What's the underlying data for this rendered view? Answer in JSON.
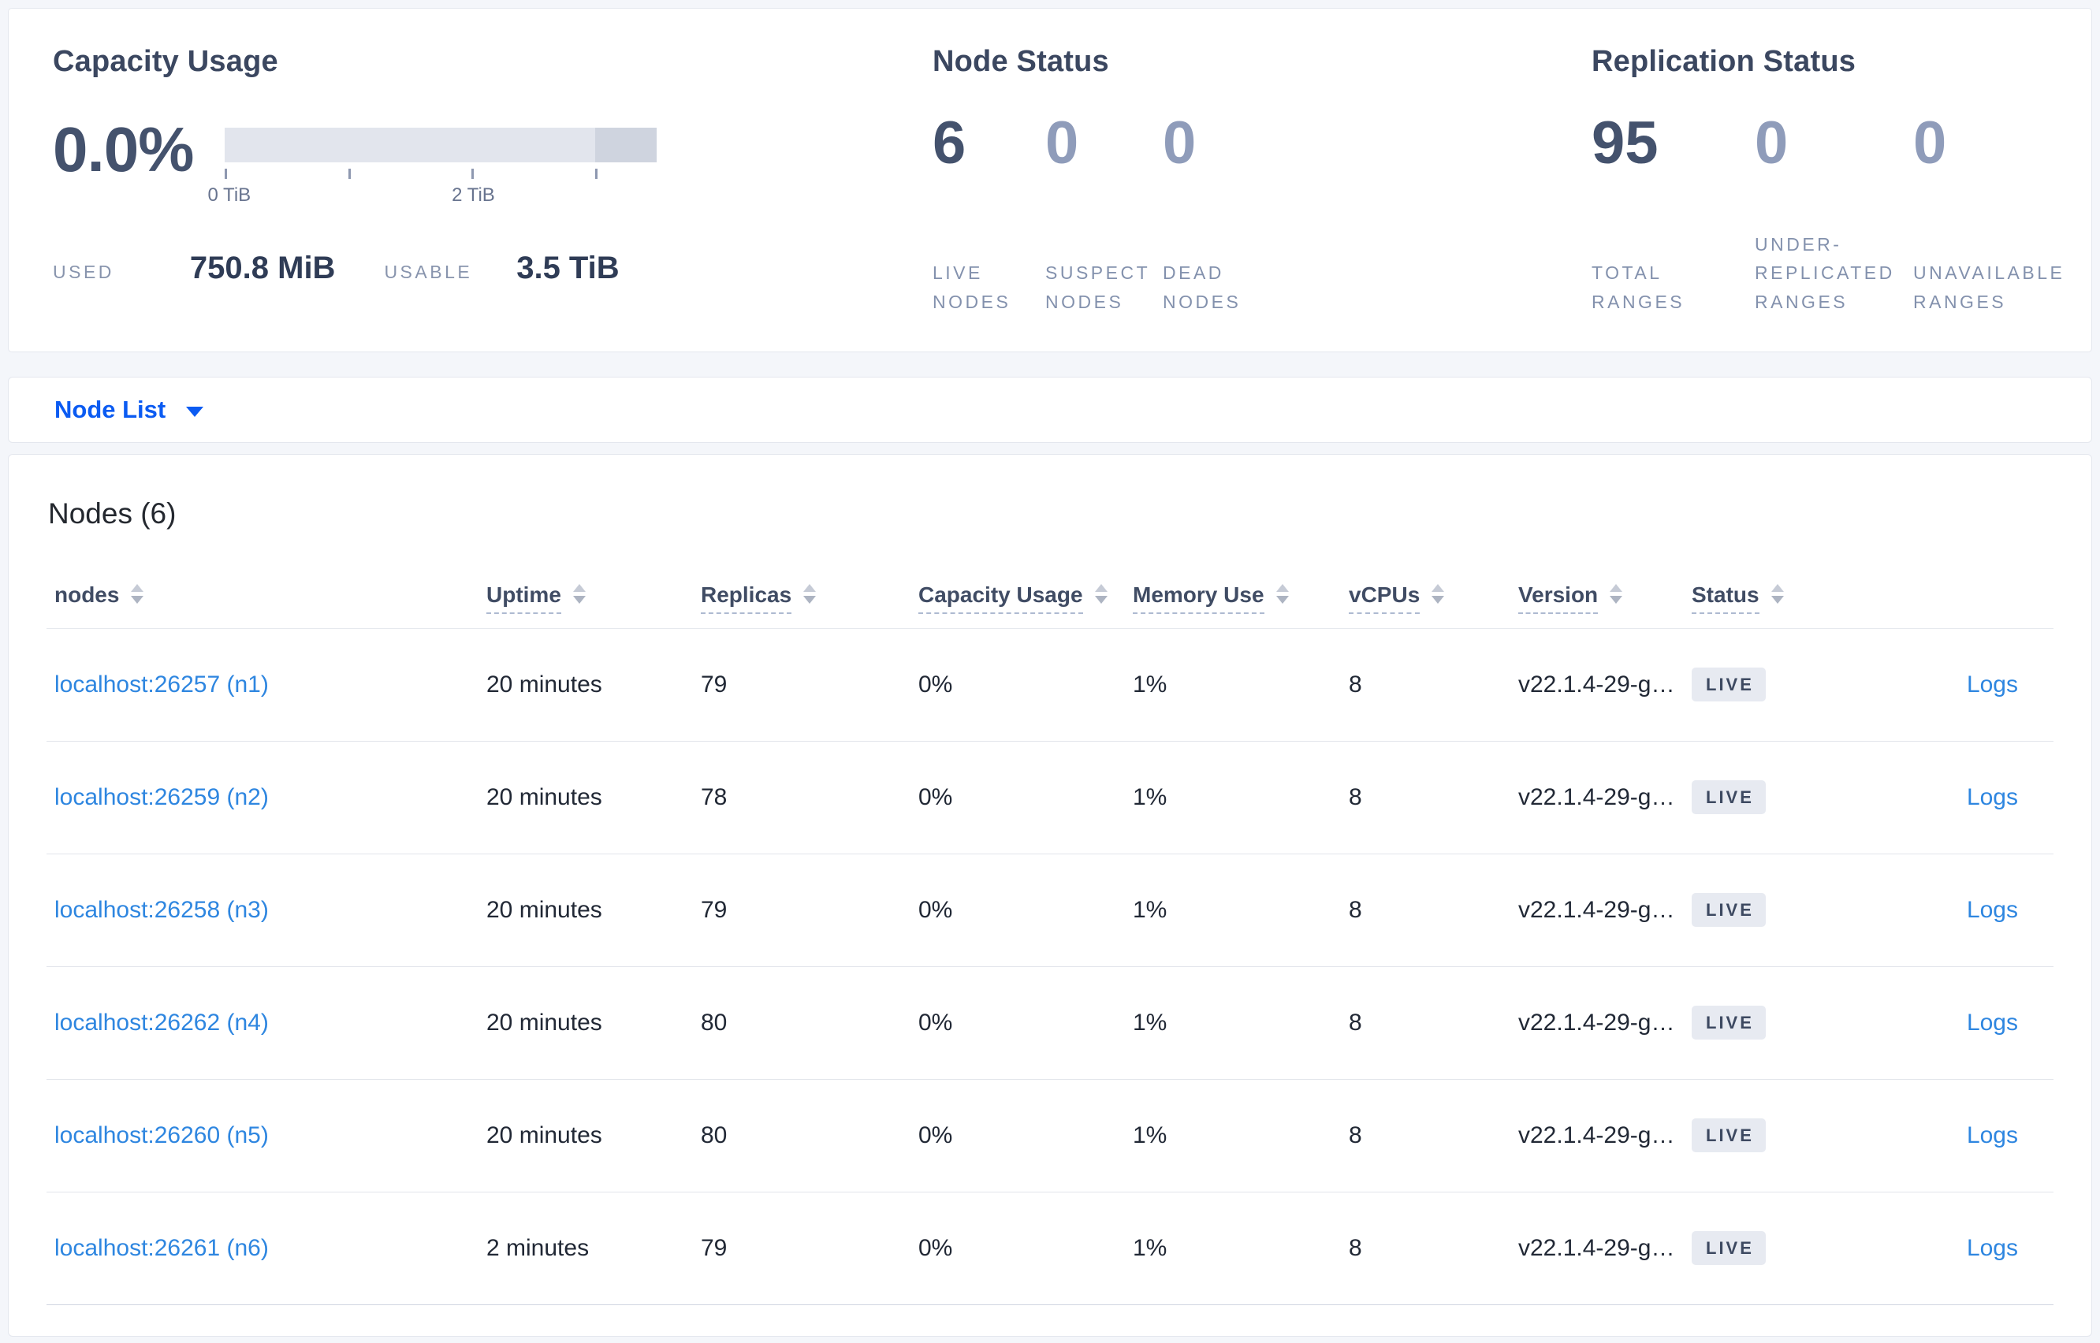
{
  "summary": {
    "capacity": {
      "title": "Capacity Usage",
      "percent": "0.0%",
      "bar": {
        "light_color": "#e2e5ed",
        "dark_color": "#cfd4df",
        "dark_segment_start_pct": 85.7,
        "tick_labels": [
          {
            "text": "0 TiB"
          },
          {
            "text": "2 TiB"
          }
        ]
      },
      "used_label": "USED",
      "used_value": "750.8 MiB",
      "usable_label": "USABLE",
      "usable_value": "3.5 TiB"
    },
    "node_status": {
      "title": "Node Status",
      "metrics": [
        {
          "value": "6",
          "label": "LIVE\nNODES"
        },
        {
          "value": "0",
          "label": "SUSPECT\nNODES"
        },
        {
          "value": "0",
          "label": "DEAD\nNODES"
        }
      ]
    },
    "replication_status": {
      "title": "Replication Status",
      "metrics": [
        {
          "value": "95",
          "label": "TOTAL\nRANGES"
        },
        {
          "value": "0",
          "label": "UNDER-\nREPLICATED\nRANGES"
        },
        {
          "value": "0",
          "label": "UNAVAILABLE\nRANGES"
        }
      ]
    }
  },
  "node_list": {
    "label": "Node List"
  },
  "nodes_table": {
    "heading": "Nodes (6)",
    "columns": [
      {
        "label": "nodes"
      },
      {
        "label": "Uptime"
      },
      {
        "label": "Replicas"
      },
      {
        "label": "Capacity Usage"
      },
      {
        "label": "Memory Use"
      },
      {
        "label": "vCPUs"
      },
      {
        "label": "Version"
      },
      {
        "label": "Status"
      }
    ],
    "rows": [
      {
        "address": "localhost:26257 (n1)",
        "uptime": "20 minutes",
        "replicas": "79",
        "capacity_usage": "0%",
        "memory_use": "1%",
        "vcpus": "8",
        "version": "v22.1.4-29-g…",
        "status": "LIVE",
        "logs": "Logs"
      },
      {
        "address": "localhost:26259 (n2)",
        "uptime": "20 minutes",
        "replicas": "78",
        "capacity_usage": "0%",
        "memory_use": "1%",
        "vcpus": "8",
        "version": "v22.1.4-29-g…",
        "status": "LIVE",
        "logs": "Logs"
      },
      {
        "address": "localhost:26258 (n3)",
        "uptime": "20 minutes",
        "replicas": "79",
        "capacity_usage": "0%",
        "memory_use": "1%",
        "vcpus": "8",
        "version": "v22.1.4-29-g…",
        "status": "LIVE",
        "logs": "Logs"
      },
      {
        "address": "localhost:26262 (n4)",
        "uptime": "20 minutes",
        "replicas": "80",
        "capacity_usage": "0%",
        "memory_use": "1%",
        "vcpus": "8",
        "version": "v22.1.4-29-g…",
        "status": "LIVE",
        "logs": "Logs"
      },
      {
        "address": "localhost:26260 (n5)",
        "uptime": "20 minutes",
        "replicas": "80",
        "capacity_usage": "0%",
        "memory_use": "1%",
        "vcpus": "8",
        "version": "v22.1.4-29-g…",
        "status": "LIVE",
        "logs": "Logs"
      },
      {
        "address": "localhost:26261 (n6)",
        "uptime": "2 minutes",
        "replicas": "79",
        "capacity_usage": "0%",
        "memory_use": "1%",
        "vcpus": "8",
        "version": "v22.1.4-29-g…",
        "status": "LIVE",
        "logs": "Logs"
      }
    ]
  },
  "colors": {
    "accent_blue": "#0b5bf2",
    "link_blue": "#2e86e0",
    "badge_bg": "#e7eaf1",
    "badge_text": "#3d4961",
    "page_bg": "#f4f6fa"
  }
}
